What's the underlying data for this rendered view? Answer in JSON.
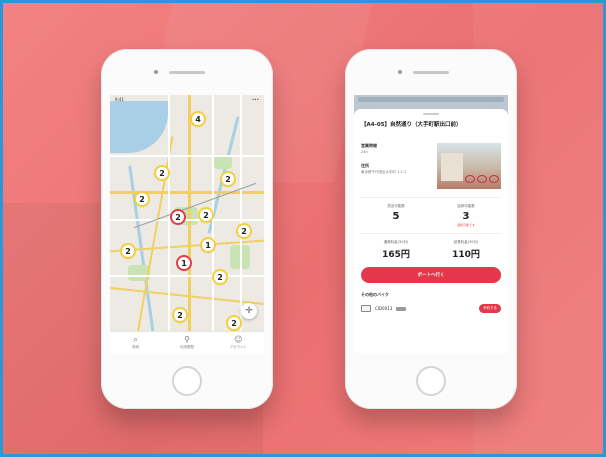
{
  "theme": {
    "background": "#ee7676",
    "frame_border": "#2e96d6",
    "accent_red": "#e4374a",
    "pin_yellow": "#f4cf3c",
    "pin_red": "#e23b4a",
    "pin_blue": "#2a8fd6"
  },
  "map_screen": {
    "status_left": "9:41",
    "status_right": "•••",
    "clusters": [
      {
        "count": "2",
        "color": "yellow"
      },
      {
        "count": "4",
        "color": "yellow"
      },
      {
        "count": "2",
        "color": "yellow"
      },
      {
        "count": "2",
        "color": "yellow"
      },
      {
        "count": "2",
        "color": "red"
      },
      {
        "count": "2",
        "color": "yellow"
      },
      {
        "count": "2",
        "color": "yellow"
      },
      {
        "count": "1",
        "color": "yellow"
      },
      {
        "count": "2",
        "color": "yellow"
      },
      {
        "count": "1",
        "color": "red"
      },
      {
        "count": "2",
        "color": "yellow"
      },
      {
        "count": "2",
        "color": "yellow"
      },
      {
        "count": "2",
        "color": "yellow"
      },
      {
        "count": "2",
        "color": "yellow"
      }
    ],
    "locate_icon": "crosshair-icon",
    "tabs": [
      {
        "icon": "search-icon",
        "label": "検索"
      },
      {
        "icon": "bike-icon",
        "label": "利用履歴"
      },
      {
        "icon": "user-icon",
        "label": "アカウント"
      }
    ]
  },
  "detail_screen": {
    "title": "【A4-05】自然通り（大手町駅出口前）",
    "address_label": "営業時間",
    "address_value": "24h",
    "location_label": "住所",
    "location_value": "東京都千代田区大手町 1-1-2",
    "stats": [
      {
        "label": "貸出可能数",
        "value": "5",
        "note": ""
      },
      {
        "label": "返却可能数",
        "value": "3",
        "note": "返却可能です"
      }
    ],
    "prices": [
      {
        "label": "通常料金(30分)",
        "value": "165円"
      },
      {
        "label": "延長料金(30分)",
        "value": "110円"
      }
    ],
    "return_button": "ポートへ行く",
    "section_title": "その他のバイク",
    "device": {
      "id": "CID0013",
      "reserve_label": "予約する"
    }
  }
}
